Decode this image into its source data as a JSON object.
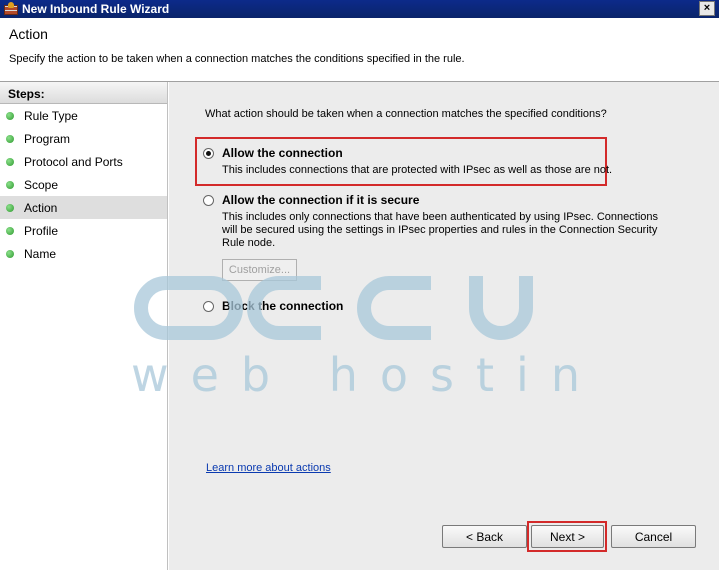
{
  "window": {
    "title": "New Inbound Rule Wizard",
    "close_glyph": "×"
  },
  "header": {
    "title": "Action",
    "description": "Specify the action to be taken when a connection matches the conditions specified in the rule."
  },
  "steps": {
    "title": "Steps:",
    "items": [
      {
        "label": "Rule Type"
      },
      {
        "label": "Program"
      },
      {
        "label": "Protocol and Ports"
      },
      {
        "label": "Scope"
      },
      {
        "label": "Action",
        "active": true
      },
      {
        "label": "Profile"
      },
      {
        "label": "Name"
      }
    ]
  },
  "main": {
    "question": "What action should be taken when a connection matches the specified conditions?",
    "options": [
      {
        "label": "Allow the connection",
        "description": "This includes connections that are protected with IPsec as well as those are not.",
        "selected": true
      },
      {
        "label": "Allow the connection if it is secure",
        "description": "This includes only connections that have been authenticated by using IPsec.  Connections will be secured using the settings in IPsec properties and rules in the Connection Security Rule node.",
        "selected": false
      },
      {
        "label": "Block the connection",
        "description": "",
        "selected": false
      }
    ],
    "customize_label": "Customize...",
    "learn_more": "Learn more about actions"
  },
  "watermark": {
    "brand": "accu",
    "tagline": "web hosting"
  },
  "buttons": {
    "back": "< Back",
    "next": "Next >",
    "cancel": "Cancel"
  }
}
